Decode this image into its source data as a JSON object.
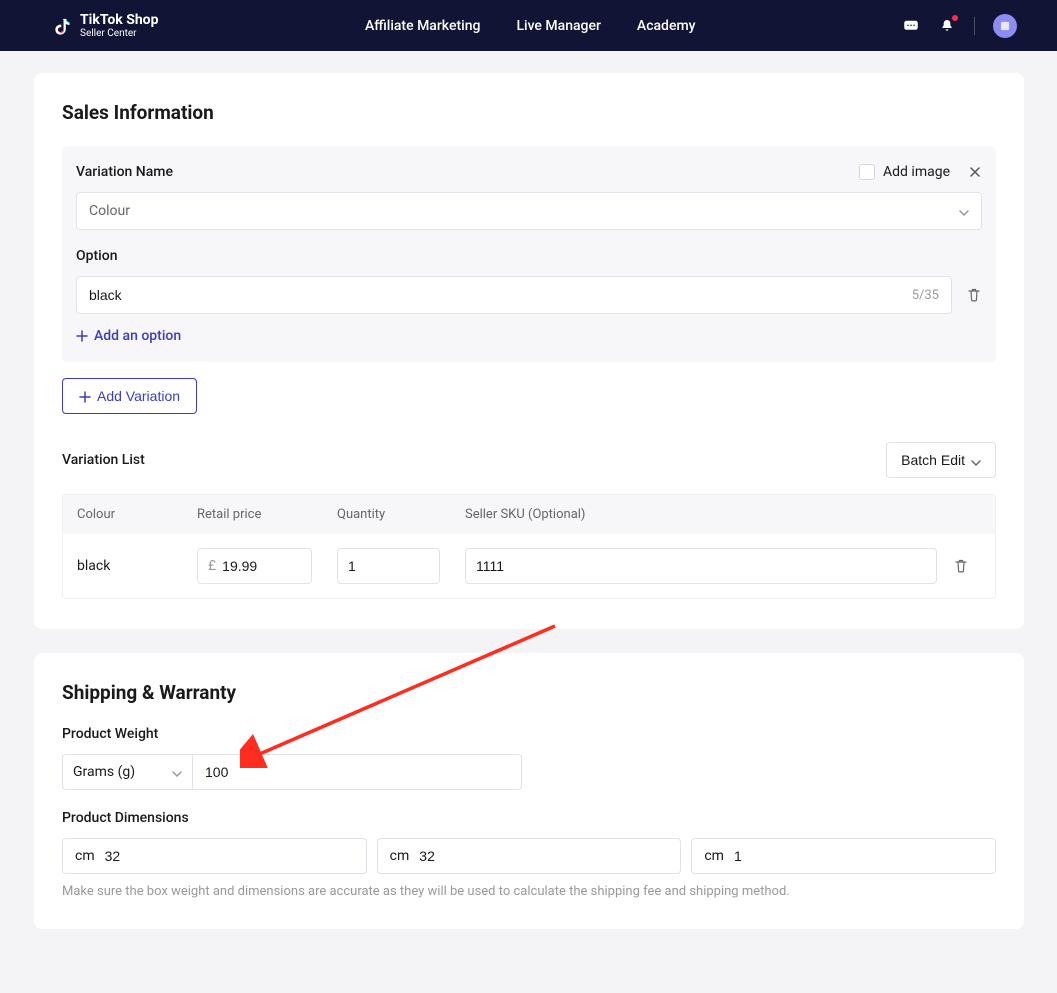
{
  "nav": {
    "brand_main": "TikTok Shop",
    "brand_sub": "Seller Center",
    "links": [
      "Affiliate Marketing",
      "Live Manager",
      "Academy"
    ]
  },
  "sales": {
    "title": "Sales Information",
    "variation_name_label": "Variation Name",
    "add_image_label": "Add image",
    "variation_name_value": "Colour",
    "option_label": "Option",
    "option_value": "black",
    "option_counter": "5/35",
    "add_option_label": "Add an option",
    "add_variation_label": "Add Variation",
    "variation_list_label": "Variation List",
    "batch_edit_label": "Batch Edit",
    "table_headers": {
      "colour": "Colour",
      "price": "Retail price",
      "qty": "Quantity",
      "sku": "Seller SKU (Optional)"
    },
    "table_row": {
      "colour": "black",
      "currency": "£",
      "price": "19.99",
      "qty": "1",
      "sku": "1111"
    }
  },
  "shipping": {
    "title": "Shipping & Warranty",
    "weight_label": "Product Weight",
    "weight_unit": "Grams (g)",
    "weight_value": "100",
    "dims_label": "Product Dimensions",
    "dim_unit": "cm",
    "dims": [
      "32",
      "32",
      "1"
    ],
    "hint": "Make sure the box weight and dimensions are accurate as they will be used to calculate the shipping fee and shipping method."
  }
}
